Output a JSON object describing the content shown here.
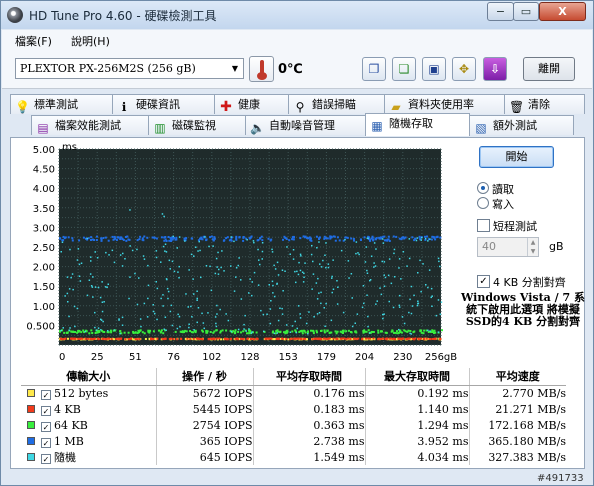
{
  "window": {
    "title": "HD Tune Pro 4.60 - 硬碟檢測工具",
    "minimize_label": "−",
    "maximize_label": "▭",
    "close_label": "X"
  },
  "menu": [
    "檔案(F)",
    "說明(H)"
  ],
  "toolbar": {
    "drive": "PLEXTOR  PX-256M2S      (256 gB)",
    "temperature": "0℃",
    "exit_label": "離開",
    "tool_icons": [
      "copy-info-icon",
      "copy-graph-icon",
      "save-icon",
      "options-icon",
      "download-icon"
    ]
  },
  "tabs_row1": [
    {
      "label": "標準測試",
      "icon": "bulb-icon"
    },
    {
      "label": "硬碟資訊",
      "icon": "info-icon"
    },
    {
      "label": "健康",
      "icon": "health-cross-icon"
    },
    {
      "label": "錯誤掃瞄",
      "icon": "magnifier-icon"
    },
    {
      "label": "資料夾使用率",
      "icon": "folder-icon"
    },
    {
      "label": "清除",
      "icon": "trash-icon"
    }
  ],
  "tabs_row2": [
    {
      "label": "檔案效能測試",
      "icon": "file-benchmark-icon"
    },
    {
      "label": "磁碟監視",
      "icon": "monitor-chart-icon"
    },
    {
      "label": "自動噪音管理",
      "icon": "speaker-icon"
    },
    {
      "label": "隨機存取",
      "icon": "random-access-icon"
    },
    {
      "label": "額外測試",
      "icon": "extra-tests-icon"
    }
  ],
  "active_tab": "隨機存取",
  "side": {
    "start_label": "開始",
    "read_label": "讀取",
    "write_label": "寫入",
    "mode": "read",
    "short_test_label": "短程測試",
    "short_test_checked": false,
    "short_test_size": "40",
    "short_test_unit": "gB",
    "align_label": "4 KB 分割對齊",
    "align_checked": true,
    "note": "Windows Vista / 7 系統下啟用此選項 將模擬SSD的4 KB 分割對齊"
  },
  "colors": {
    "chart_bg": "#1f2b2b",
    "grid": "#3d5454",
    "s512": "#ffe94a",
    "s4k": "#f23a1b",
    "s64k": "#38ee3d",
    "s1m": "#1f6de4",
    "random": "#3fd8e4"
  },
  "chart_data": {
    "type": "scatter",
    "y_unit": "ms",
    "x_unit": "gB",
    "xlim": [
      0,
      256
    ],
    "ylim": [
      0,
      5
    ],
    "x_ticks": [
      "0",
      "25",
      "51",
      "76",
      "102",
      "128",
      "153",
      "179",
      "204",
      "230",
      "256gB"
    ],
    "y_ticks": [
      "5.00",
      "4.50",
      "4.00",
      "3.50",
      "3.00",
      "2.50",
      "2.00",
      "1.50",
      "1.00",
      "0.500"
    ],
    "series": [
      {
        "name": "512 bytes",
        "color": "#ffe94a",
        "center": 0.176,
        "spread": 0.01,
        "max": 0.192
      },
      {
        "name": "4 KB",
        "color": "#f23a1b",
        "center": 0.183,
        "spread": 0.01,
        "max": 1.14
      },
      {
        "name": "64 KB",
        "color": "#38ee3d",
        "center": 0.363,
        "spread": 0.04,
        "max": 1.294
      },
      {
        "name": "1 MB",
        "color": "#1f6de4",
        "center": 2.738,
        "spread": 0.06,
        "max": 3.952
      },
      {
        "name": "隨機",
        "color": "#3fd8e4",
        "center": 1.549,
        "spread": 0.6,
        "max": 4.034
      }
    ]
  },
  "table": {
    "headers": [
      "傳輸大小",
      "操作 / 秒",
      "平均存取時間",
      "最大存取時間",
      "平均速度"
    ],
    "rows": [
      {
        "size": "512 bytes",
        "color": "#ffe94a",
        "iops": "5672 IOPS",
        "avg": "0.176 ms",
        "max": "0.192 ms",
        "speed": "2.770 MB/s"
      },
      {
        "size": "4 KB",
        "color": "#f23a1b",
        "iops": "5445 IOPS",
        "avg": "0.183 ms",
        "max": "1.140 ms",
        "speed": "21.271 MB/s"
      },
      {
        "size": "64 KB",
        "color": "#38ee3d",
        "iops": "2754 IOPS",
        "avg": "0.363 ms",
        "max": "1.294 ms",
        "speed": "172.168 MB/s"
      },
      {
        "size": "1 MB",
        "color": "#1f6de4",
        "iops": "365 IOPS",
        "avg": "2.738 ms",
        "max": "3.952 ms",
        "speed": "365.180 MB/s"
      },
      {
        "size": "隨機",
        "color": "#3fd8e4",
        "iops": "645 IOPS",
        "avg": "1.549 ms",
        "max": "4.034 ms",
        "speed": "327.383 MB/s"
      }
    ]
  },
  "watermark": "#491733"
}
